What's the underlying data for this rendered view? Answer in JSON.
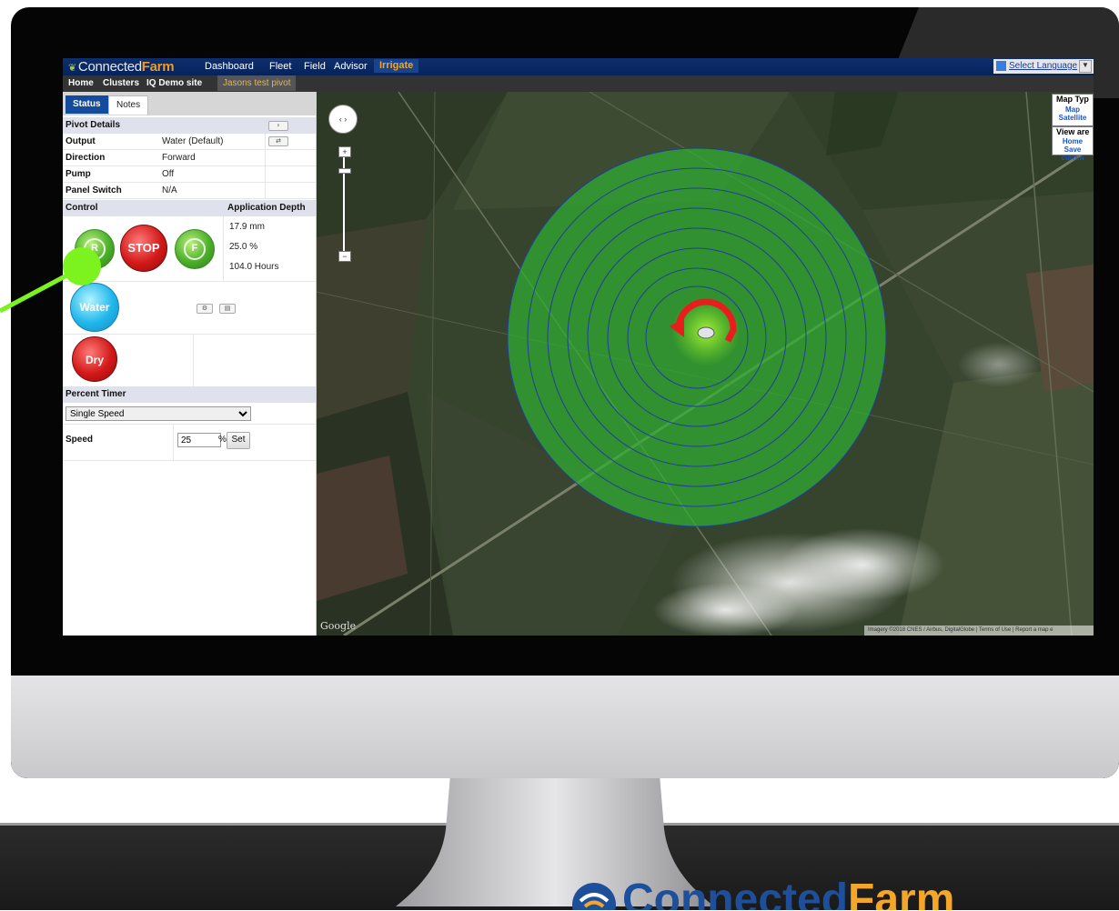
{
  "app": {
    "logo_prefix": "Connected",
    "logo_suffix": "Farm",
    "nav": [
      "Dashboard",
      "Fleet",
      "Field",
      "Advisor",
      "Irrigate"
    ],
    "language": "Select Language"
  },
  "subnav": [
    "Home",
    "Clusters",
    "IQ Demo site",
    "Jasons test pivot"
  ],
  "panel": {
    "tabs": [
      "Status",
      "Notes"
    ],
    "pivot_details": "Pivot Details",
    "rows": [
      {
        "k": "Output",
        "v": "Water (Default)"
      },
      {
        "k": "Direction",
        "v": "Forward"
      },
      {
        "k": "Pump",
        "v": "Off"
      },
      {
        "k": "Panel Switch",
        "v": "N/A"
      }
    ],
    "control": "Control",
    "application_depth": "Application Depth",
    "depth_mm": "17.9 mm",
    "depth_pct": "25.0 %",
    "depth_hours": "104.0 Hours",
    "btn_reverse": "R",
    "btn_stop": "STOP",
    "btn_forward": "F",
    "btn_water": "Water",
    "btn_dry": "Dry",
    "percent_timer": "Percent Timer",
    "timer_option": "Single Speed",
    "speed_label": "Speed",
    "speed_value": "25",
    "speed_unit": "%",
    "set_label": "Set"
  },
  "map": {
    "map_type_title": "Map Typ",
    "map_type_map": "Map",
    "map_type_satellite": "Satellite",
    "view_area_title": "View are",
    "view_home": "Home",
    "view_save": "Save curren",
    "google": "Google",
    "attribution": "Imagery ©2018 CNES / Airbus, DigitalGlobe | Terms of Use | Report a map e",
    "pivot_fill_color": "#2fae32",
    "ring_color": "#1f3fa0",
    "direction_arrow_color": "#e81d1d"
  }
}
